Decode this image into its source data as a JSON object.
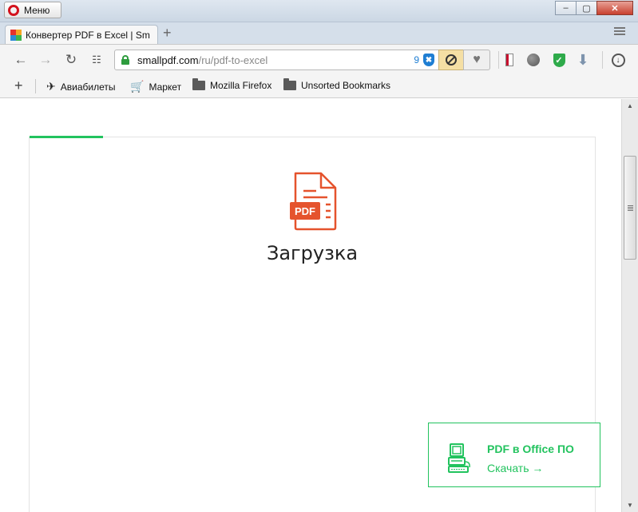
{
  "window": {
    "menu_label": "Меню",
    "controls": [
      "–",
      "▢",
      "✕"
    ]
  },
  "tabs": [
    {
      "title": "Конвертер PDF в Excel | Sm"
    }
  ],
  "new_tab_symbol": "+",
  "toolbar": {
    "url_domain": "smallpdf.com",
    "url_path": "/ru/pdf-to-excel",
    "blocked_ads_count": "9"
  },
  "bookmarks": [
    {
      "label": "Авиабилеты",
      "icon": "plane-icon"
    },
    {
      "label": "Маркет",
      "icon": "cart-icon"
    },
    {
      "label": "Mozilla Firefox",
      "icon": "folder-icon"
    },
    {
      "label": "Unsorted Bookmarks",
      "icon": "folder-icon"
    }
  ],
  "page": {
    "upload_progress": 0.13,
    "pdf_badge": "PDF",
    "upload_title": "Загрузка",
    "promo": {
      "title": "PDF в Office ПО",
      "link": "Скачать →"
    }
  },
  "colors": {
    "accent_green": "#22c35e",
    "pdf_red": "#e5532d",
    "opera_red": "#d3121d"
  }
}
